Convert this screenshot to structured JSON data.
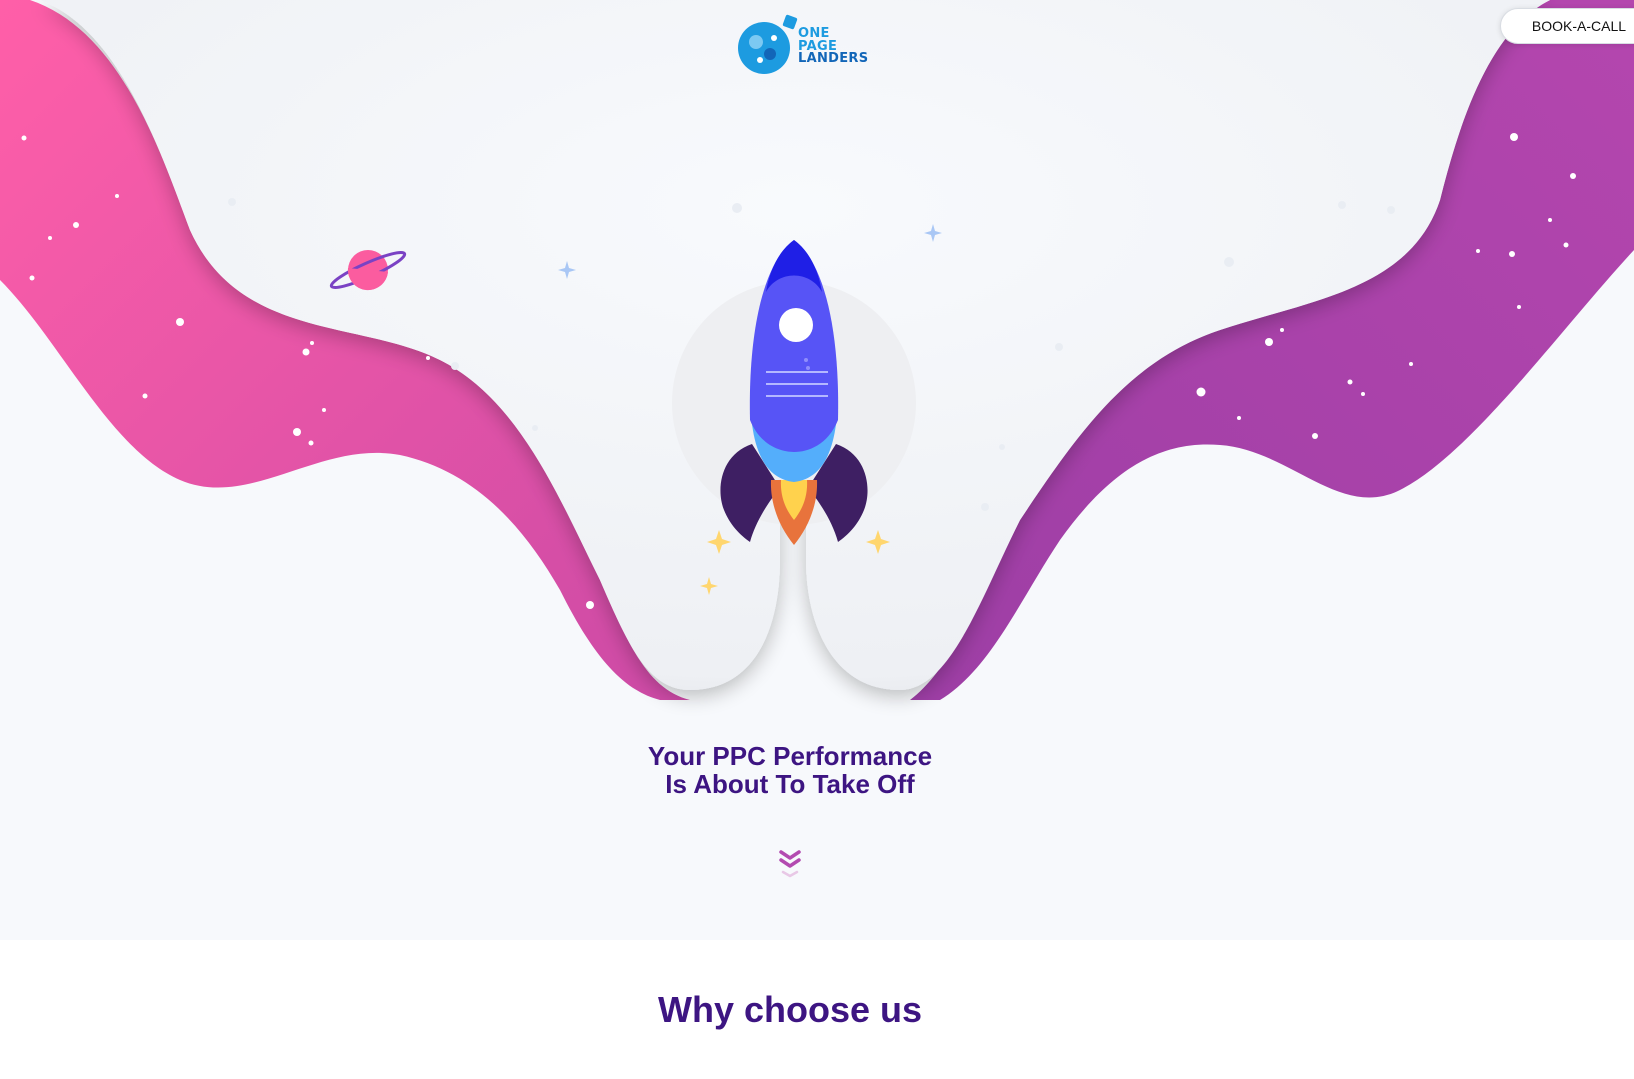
{
  "brand": {
    "logo_lines": [
      "ONE",
      "PAGE",
      "LANDERS"
    ],
    "primary_color": "#3d1582",
    "accent_pink": "#ff5fa8",
    "accent_purple": "#b046b0"
  },
  "header": {
    "cta_label": "BOOK-A-CALL"
  },
  "hero": {
    "headline_line1": "Your PPC Performance",
    "headline_line2": "Is About To Take Off",
    "illustration": "rocket-launch"
  },
  "next_section": {
    "title": "Why choose us"
  },
  "icons": [
    "planet-icon",
    "rocket-icon",
    "sparkle-icon",
    "chevron-down-icon"
  ]
}
